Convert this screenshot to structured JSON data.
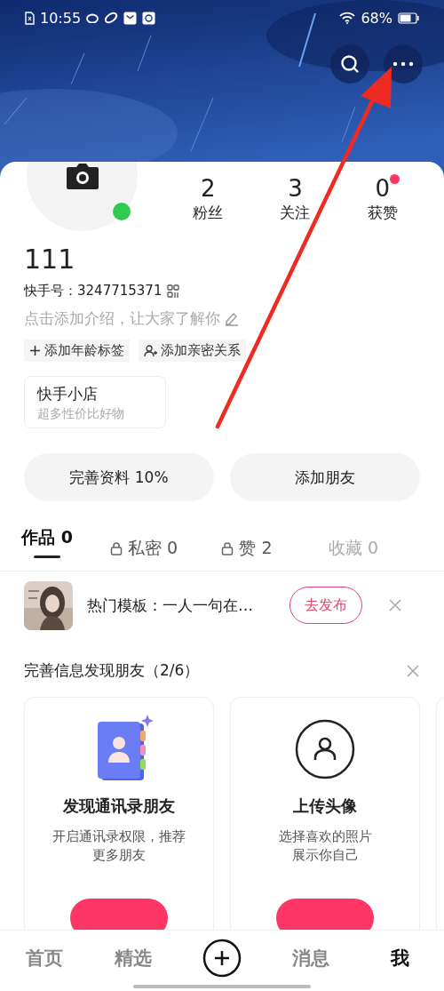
{
  "status_bar": {
    "time": "10:55",
    "battery": "68%"
  },
  "profile": {
    "online": true,
    "name": "111",
    "account_id": "快手号：3247715371",
    "intro_placeholder": "点击添加介绍，让大家了解你",
    "stats": [
      {
        "value": "2",
        "label": "粉丝",
        "new_dot": false
      },
      {
        "value": "3",
        "label": "关注",
        "new_dot": false
      },
      {
        "value": "0",
        "label": "获赞",
        "new_dot": true
      }
    ],
    "tags": [
      {
        "kind": "add",
        "label": "添加年龄标签"
      },
      {
        "kind": "person",
        "label": "添加亲密关系"
      }
    ],
    "shop": {
      "title": "快手小店",
      "subtitle": "超多性价比好物"
    }
  },
  "actions": [
    {
      "label": "完善资料 10%"
    },
    {
      "label": "添加朋友"
    }
  ],
  "tabs": [
    {
      "label": "作品 0",
      "locked": false,
      "selected": true
    },
    {
      "label": "私密 0",
      "locked": true,
      "selected": false
    },
    {
      "label": "赞 2",
      "locked": true,
      "selected": false
    },
    {
      "label": "收藏 0",
      "locked": false,
      "selected": false
    }
  ],
  "template_banner": {
    "text": "热门模板：一人一句在…",
    "button": "去发布"
  },
  "friend_section": {
    "title": "完善信息发现朋友（2/6）",
    "cards": [
      {
        "kind": "contacts",
        "title": "发现通讯录朋友",
        "description_lines": [
          "开启通讯录权限，推荐",
          "更多朋友"
        ]
      },
      {
        "kind": "avatar",
        "title": "上传头像",
        "description_lines": [
          "选择喜欢的照片",
          "展示你自己"
        ]
      }
    ]
  },
  "bottom_nav": [
    {
      "kind": "text",
      "label": "首页",
      "selected": false
    },
    {
      "kind": "text",
      "label": "精选",
      "selected": false
    },
    {
      "kind": "add",
      "selected": false
    },
    {
      "kind": "text",
      "label": "消息",
      "selected": false
    },
    {
      "kind": "text",
      "label": "我",
      "selected": true
    }
  ]
}
